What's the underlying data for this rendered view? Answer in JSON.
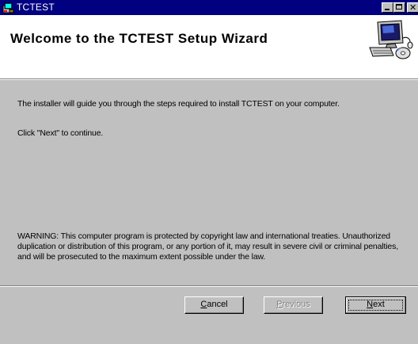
{
  "window": {
    "title": "TCTEST",
    "controls": {
      "minimize": "_",
      "maximize": "□",
      "close": "✕"
    },
    "title_color": "#000080"
  },
  "banner": {
    "title": "Welcome to the TCTEST Setup Wizard",
    "icon": "computer-setup-icon"
  },
  "content": {
    "intro": "The installer will guide you through the steps required to install TCTEST on your computer.",
    "instruction": "Click \"Next\" to continue.",
    "warning": "WARNING: This computer program is protected by copyright law and international treaties. Unauthorized duplication or distribution of this program, or any portion of it, may result in severe civil or criminal penalties, and will be prosecuted to the maximum extent possible under the law."
  },
  "buttons": {
    "cancel": {
      "mnemonic": "C",
      "rest": "ancel"
    },
    "previous": {
      "mnemonic": "P",
      "rest": "revious",
      "enabled": false
    },
    "next": {
      "mnemonic": "N",
      "rest": "ext"
    }
  }
}
